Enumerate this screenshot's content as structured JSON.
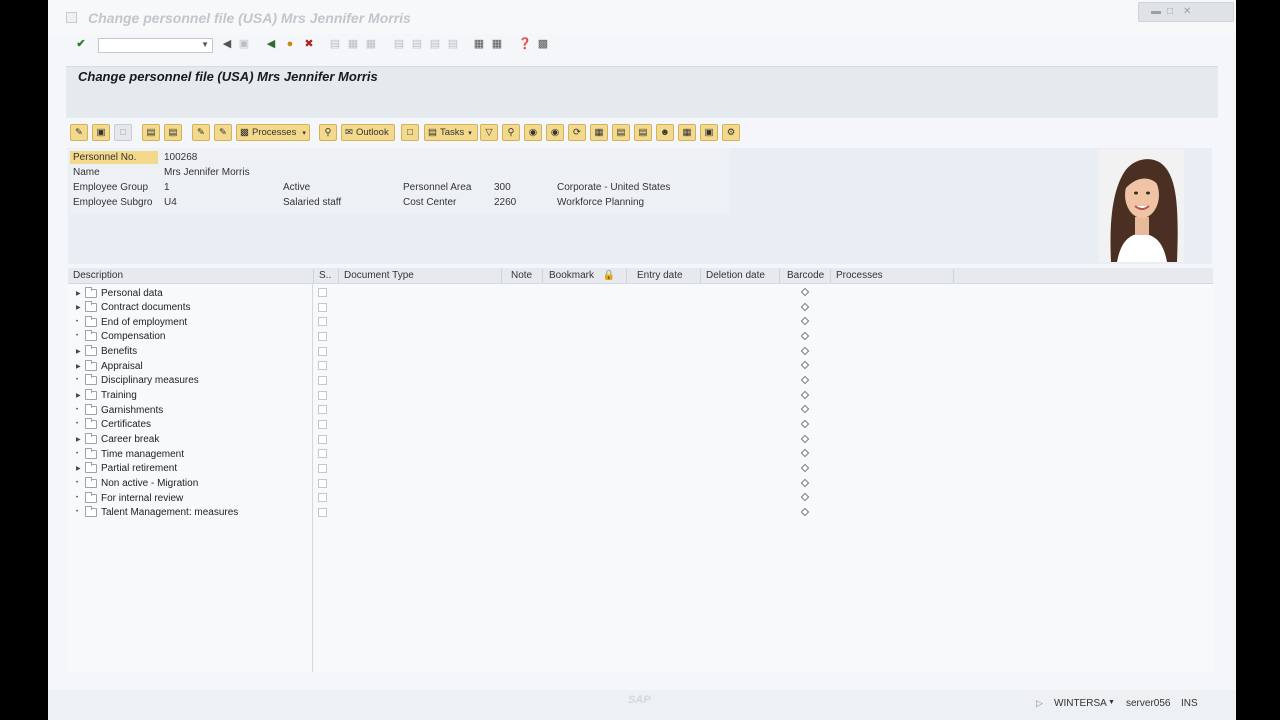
{
  "window": {
    "title": "Change personnel file (USA) Mrs Jennifer Morris"
  },
  "header": {
    "title": "Change personnel file (USA) Mrs Jennifer Morris"
  },
  "toolbar": {
    "processes_label": "Processes",
    "outlook_label": "Outlook",
    "tasks_label": "Tasks"
  },
  "employee": {
    "personnel_no_label": "Personnel No.",
    "personnel_no": "100268",
    "name_label": "Name",
    "name": "Mrs Jennifer Morris",
    "employee_group_label": "Employee Group",
    "employee_group": "1",
    "employee_group_text": "Active",
    "employee_subgroup_label": "Employee Subgro",
    "employee_subgroup": "U4",
    "employee_subgroup_text": "Salaried staff",
    "personnel_area_label": "Personnel Area",
    "personnel_area": "300",
    "personnel_area_text": "Corporate - United States",
    "cost_center_label": "Cost Center",
    "cost_center": "2260",
    "cost_center_text": "Workforce Planning"
  },
  "table": {
    "columns": [
      "Description",
      "S..",
      "Document Type",
      "Note",
      "Bookmark",
      "Entry date",
      "Deletion date",
      "Barcode",
      "Processes"
    ],
    "rows": [
      "Personal data",
      "Contract documents",
      "End of employment",
      "Compensation",
      "Benefits",
      "Appraisal",
      "Disciplinary measures",
      "Training",
      "Garnishments",
      "Certificates",
      "Career break",
      "Time management",
      "Partial retirement",
      "Non active - Migration",
      "For internal review",
      "Talent Management: measures"
    ]
  },
  "status": {
    "user": "WINTERSA",
    "server": "server056",
    "mode": "INS",
    "logo": "SAP"
  },
  "colors": {
    "accent": "#f3d98b",
    "header_band": "#e5eaef",
    "panel": "#e9eef4"
  }
}
